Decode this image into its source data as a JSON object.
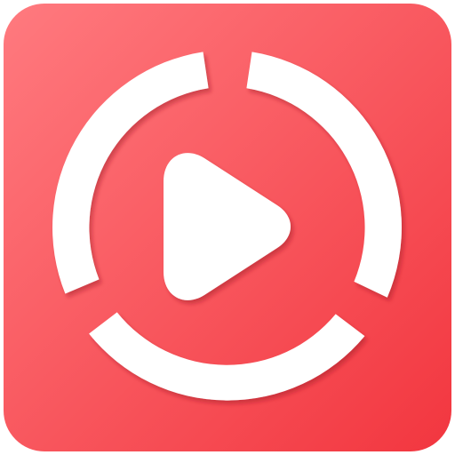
{
  "icon": {
    "name": "video-player-app-icon",
    "symbol": "play-icon",
    "colors": {
      "background_top_left": "#ff7a7f",
      "background_bottom_right": "#f2363f",
      "foreground": "#ffffff",
      "shadow": "#9e1e26"
    }
  }
}
